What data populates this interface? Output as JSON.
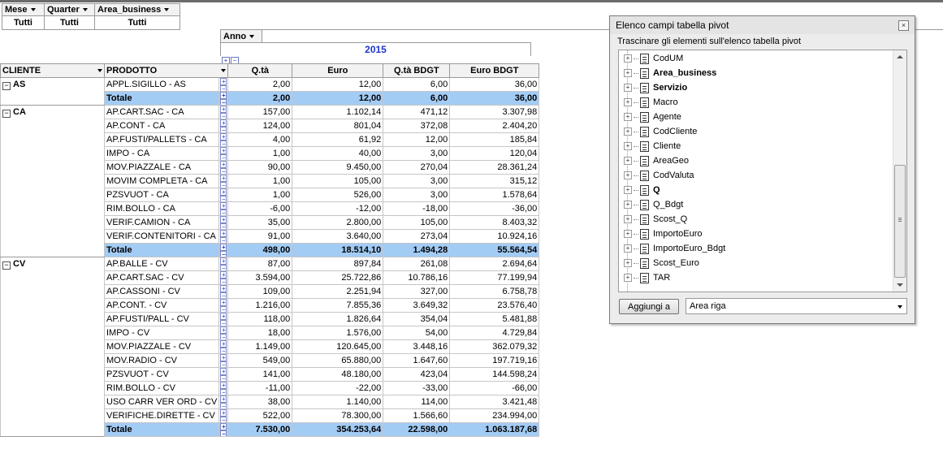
{
  "filters": [
    {
      "label": "Mese",
      "value": "Tutti"
    },
    {
      "label": "Quarter",
      "value": "Tutti"
    },
    {
      "label": "Area_business",
      "value": "Tutti"
    }
  ],
  "column_field": "Anno",
  "column_value": "2015",
  "row_headers": {
    "cliente": "CLIENTE",
    "prodotto": "PRODOTTO"
  },
  "measures": [
    "Q.tà",
    "Euro",
    "Q.tà BDGT",
    "Euro BDGT"
  ],
  "total_label": "Totale",
  "groups": [
    {
      "cliente": "AS",
      "rows": [
        {
          "prodotto": "APPL.SIGILLO - AS",
          "v": [
            "2,00",
            "12,00",
            "6,00",
            "36,00"
          ]
        }
      ],
      "total": [
        "2,00",
        "12,00",
        "6,00",
        "36,00"
      ]
    },
    {
      "cliente": "CA",
      "rows": [
        {
          "prodotto": "AP.CART.SAC - CA",
          "v": [
            "157,00",
            "1.102,14",
            "471,12",
            "3.307,98"
          ]
        },
        {
          "prodotto": "AP.CONT - CA",
          "v": [
            "124,00",
            "801,04",
            "372,08",
            "2.404,20"
          ]
        },
        {
          "prodotto": "AP.FUSTI/PALLETS - CA",
          "v": [
            "4,00",
            "61,92",
            "12,00",
            "185,84"
          ]
        },
        {
          "prodotto": "IMPO - CA",
          "v": [
            "1,00",
            "40,00",
            "3,00",
            "120,04"
          ]
        },
        {
          "prodotto": "MOV.PIAZZALE - CA",
          "v": [
            "90,00",
            "9.450,00",
            "270,04",
            "28.361,24"
          ]
        },
        {
          "prodotto": "MOVIM COMPLETA - CA",
          "v": [
            "1,00",
            "105,00",
            "3,00",
            "315,12"
          ]
        },
        {
          "prodotto": "PZSVUOT - CA",
          "v": [
            "1,00",
            "526,00",
            "3,00",
            "1.578,64"
          ]
        },
        {
          "prodotto": "RIM.BOLLO - CA",
          "v": [
            "-6,00",
            "-12,00",
            "-18,00",
            "-36,00"
          ]
        },
        {
          "prodotto": "VERIF.CAMION - CA",
          "v": [
            "35,00",
            "2.800,00",
            "105,00",
            "8.403,32"
          ]
        },
        {
          "prodotto": "VERIF.CONTENITORI - CA",
          "v": [
            "91,00",
            "3.640,00",
            "273,04",
            "10.924,16"
          ]
        }
      ],
      "total": [
        "498,00",
        "18.514,10",
        "1.494,28",
        "55.564,54"
      ]
    },
    {
      "cliente": "CV",
      "rows": [
        {
          "prodotto": "AP.BALLE - CV",
          "v": [
            "87,00",
            "897,84",
            "261,08",
            "2.694,64"
          ]
        },
        {
          "prodotto": "AP.CART.SAC - CV",
          "v": [
            "3.594,00",
            "25.722,86",
            "10.786,16",
            "77.199,94"
          ]
        },
        {
          "prodotto": "AP.CASSONI - CV",
          "v": [
            "109,00",
            "2.251,94",
            "327,00",
            "6.758,78"
          ]
        },
        {
          "prodotto": "AP.CONT. - CV",
          "v": [
            "1.216,00",
            "7.855,36",
            "3.649,32",
            "23.576,40"
          ]
        },
        {
          "prodotto": "AP.FUSTI/PALL - CV",
          "v": [
            "118,00",
            "1.826,64",
            "354,04",
            "5.481,88"
          ]
        },
        {
          "prodotto": "IMPO - CV",
          "v": [
            "18,00",
            "1.576,00",
            "54,00",
            "4.729,84"
          ]
        },
        {
          "prodotto": "MOV.PIAZZALE - CV",
          "v": [
            "1.149,00",
            "120.645,00",
            "3.448,16",
            "362.079,32"
          ]
        },
        {
          "prodotto": "MOV.RADIO - CV",
          "v": [
            "549,00",
            "65.880,00",
            "1.647,60",
            "197.719,16"
          ]
        },
        {
          "prodotto": "PZSVUOT - CV",
          "v": [
            "141,00",
            "48.180,00",
            "423,04",
            "144.598,24"
          ]
        },
        {
          "prodotto": "RIM.BOLLO - CV",
          "v": [
            "-11,00",
            "-22,00",
            "-33,00",
            "-66,00"
          ]
        },
        {
          "prodotto": "USO CARR VER ORD - CV",
          "v": [
            "38,00",
            "1.140,00",
            "114,00",
            "3.421,48"
          ]
        },
        {
          "prodotto": "VERIFICHE.DIRETTE - CV",
          "v": [
            "522,00",
            "78.300,00",
            "1.566,60",
            "234.994,00"
          ]
        }
      ],
      "total": [
        "7.530,00",
        "354.253,64",
        "22.598,00",
        "1.063.187,68"
      ]
    }
  ],
  "field_list": {
    "title": "Elenco campi tabella pivot",
    "close_glyph": "×",
    "instructions": "Trascinare gli elementi sull'elenco tabella pivot",
    "fields": [
      {
        "label": "CodUM",
        "bold": false
      },
      {
        "label": "Area_business",
        "bold": true
      },
      {
        "label": "Servizio",
        "bold": true
      },
      {
        "label": "Macro",
        "bold": false
      },
      {
        "label": "Agente",
        "bold": false
      },
      {
        "label": "CodCliente",
        "bold": false
      },
      {
        "label": "Cliente",
        "bold": false
      },
      {
        "label": "AreaGeo",
        "bold": false
      },
      {
        "label": "CodValuta",
        "bold": false
      },
      {
        "label": "Q",
        "bold": true
      },
      {
        "label": "Q_Bdgt",
        "bold": false
      },
      {
        "label": "Scost_Q",
        "bold": false
      },
      {
        "label": "ImportoEuro",
        "bold": false
      },
      {
        "label": "ImportoEuro_Bdgt",
        "bold": false
      },
      {
        "label": "Scost_Euro",
        "bold": false
      },
      {
        "label": "TAR",
        "bold": false
      }
    ],
    "add_button": "Aggiungi a",
    "add_target": "Area riga"
  }
}
